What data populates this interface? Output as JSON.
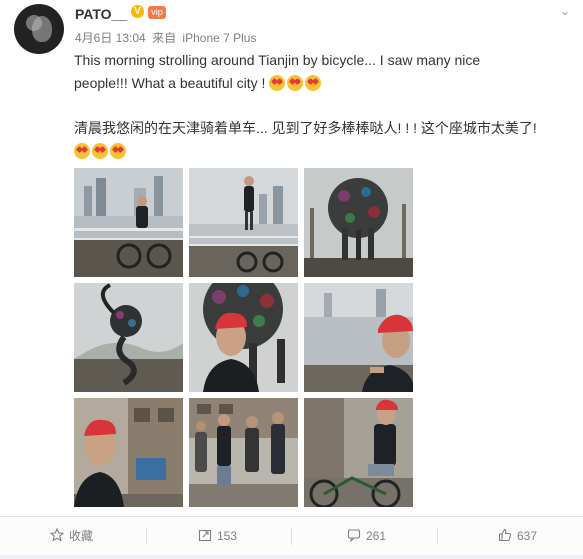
{
  "post": {
    "username": "PATO__",
    "verified_symbol": "V",
    "vip_label": "vip",
    "date": "4月6日 13:04",
    "source_prefix": "来自",
    "source": "iPhone 7 Plus",
    "text_en_line1": "This morning strolling around Tianjin by bicycle... I saw many nice",
    "text_en_line2": "people!!!  What a beautiful city ! ",
    "text_cn_line1": "清晨我悠闲的在天津骑着单车... 见到了好多棒棒哒人! ! ! 这个座城市太美了!",
    "emoji_name": "heart-eyes-emoji"
  },
  "photos": [
    {
      "name": "photo-bike-riverside-1",
      "scene": "river"
    },
    {
      "name": "photo-standing-on-railing",
      "scene": "river"
    },
    {
      "name": "photo-flower-sculpture",
      "scene": "sculpture"
    },
    {
      "name": "photo-twisted-sculpture",
      "scene": "sculpture"
    },
    {
      "name": "photo-selfie-sculpture",
      "scene": "selfie"
    },
    {
      "name": "photo-red-cap-river",
      "scene": "river"
    },
    {
      "name": "photo-selfie-alley",
      "scene": "street"
    },
    {
      "name": "photo-street-with-locals",
      "scene": "street"
    },
    {
      "name": "photo-sitting-on-bike",
      "scene": "street"
    }
  ],
  "actions": {
    "favorite_label": "收藏",
    "repost_count": "153",
    "comment_count": "261",
    "like_count": "637"
  },
  "colors": {
    "text": "#333333",
    "meta": "#808080",
    "verified": "#ffb400",
    "cap_red": "#d8353a"
  }
}
